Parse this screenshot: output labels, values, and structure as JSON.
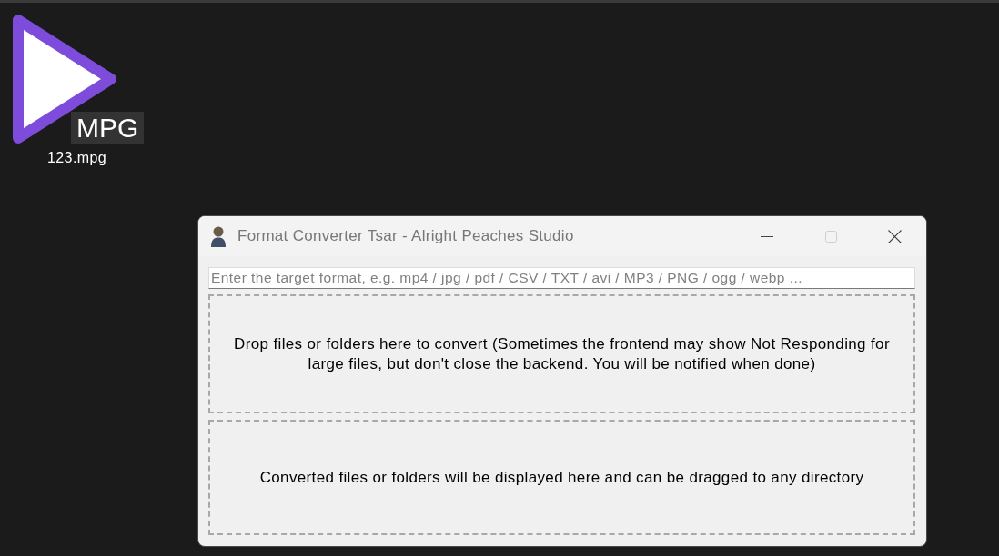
{
  "desktop": {
    "icons": [
      {
        "badge": "MPG",
        "label": "123.mpg"
      }
    ]
  },
  "window": {
    "title": "Format Converter Tsar - Alright Peaches Studio",
    "controls": [
      {
        "kind": "minimize",
        "disabled": false
      },
      {
        "kind": "maximize",
        "disabled": true
      },
      {
        "kind": "close",
        "disabled": false
      }
    ]
  },
  "format_field": {
    "placeholder": "Enter the target format, e.g. mp4 / jpg / pdf / CSV / TXT / avi / MP3 / PNG / ogg / webp ..."
  },
  "drop_zone": {
    "text": "Drop files or folders here to convert (Sometimes the frontend may show Not Responding for large files, but don't close the backend. You will be notified when done)"
  },
  "output_zone": {
    "text": "Converted files or folders will be displayed here and can be dragged to any directory"
  }
}
